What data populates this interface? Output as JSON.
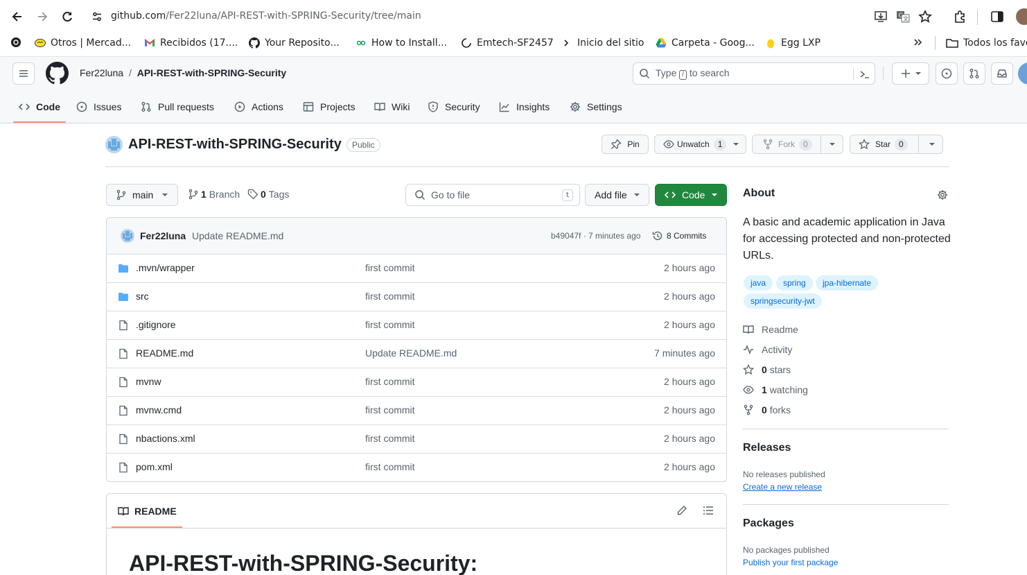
{
  "browser": {
    "url_host": "github.com",
    "url_path": "/Fer22luna/API-REST-with-SPRING-Security/tree/main",
    "bookmarks": [
      {
        "label": "Otros | Mercad...",
        "icon": "mercadolibre-icon"
      },
      {
        "label": "Recibidos (17....",
        "icon": "gmail-icon"
      },
      {
        "label": "Your Reposito...",
        "icon": "github-icon"
      },
      {
        "label": "How to Install...",
        "icon": "link-icon"
      },
      {
        "label": "Emtech-SF2457",
        "icon": "loading-icon"
      },
      {
        "label": "Inicio del sitio",
        "icon": "arrow-icon"
      },
      {
        "label": "Carpeta - Goog...",
        "icon": "drive-icon"
      },
      {
        "label": "Egg LXP",
        "icon": "egg-icon"
      }
    ],
    "all_bookmarks": "Todos los favo"
  },
  "header": {
    "owner": "Fer22luna",
    "separator": "/",
    "repo": "API-REST-with-SPRING-Security",
    "search_placeholder_pre": "Type",
    "search_key": "/",
    "search_placeholder_post": "to search"
  },
  "tabs": [
    {
      "label": "Code",
      "icon": "code-icon",
      "selected": true
    },
    {
      "label": "Issues",
      "icon": "issue-icon"
    },
    {
      "label": "Pull requests",
      "icon": "pull-request-icon"
    },
    {
      "label": "Actions",
      "icon": "play-icon"
    },
    {
      "label": "Projects",
      "icon": "table-icon"
    },
    {
      "label": "Wiki",
      "icon": "book-icon"
    },
    {
      "label": "Security",
      "icon": "shield-icon"
    },
    {
      "label": "Insights",
      "icon": "graph-icon"
    },
    {
      "label": "Settings",
      "icon": "gear-icon"
    }
  ],
  "repo": {
    "name": "API-REST-with-SPRING-Security",
    "visibility": "Public",
    "pin": "Pin",
    "unwatch": "Unwatch",
    "watch_count": "1",
    "fork": "Fork",
    "fork_count": "0",
    "star": "Star",
    "star_count": "0"
  },
  "toolbar": {
    "branch": "main",
    "branch_count": "1",
    "branch_label": "Branch",
    "tag_count": "0",
    "tag_label": "Tags",
    "goto_placeholder": "Go to file",
    "goto_key": "t",
    "add_file": "Add file",
    "code": "Code"
  },
  "commit": {
    "author": "Fer22luna",
    "message": "Update README.md",
    "hash_age": "b49047f · 7 minutes ago",
    "commits": "8 Commits"
  },
  "files": [
    {
      "name": ".mvn/wrapper",
      "type": "folder",
      "message": "first commit",
      "age": "2 hours ago"
    },
    {
      "name": "src",
      "type": "folder",
      "message": "first commit",
      "age": "2 hours ago"
    },
    {
      "name": ".gitignore",
      "type": "file",
      "message": "first commit",
      "age": "2 hours ago"
    },
    {
      "name": "README.md",
      "type": "file",
      "message": "Update README.md",
      "age": "7 minutes ago"
    },
    {
      "name": "mvnw",
      "type": "file",
      "message": "first commit",
      "age": "2 hours ago"
    },
    {
      "name": "mvnw.cmd",
      "type": "file",
      "message": "first commit",
      "age": "2 hours ago"
    },
    {
      "name": "nbactions.xml",
      "type": "file",
      "message": "first commit",
      "age": "2 hours ago"
    },
    {
      "name": "pom.xml",
      "type": "file",
      "message": "first commit",
      "age": "2 hours ago"
    }
  ],
  "readme": {
    "tab": "README",
    "heading": "API-REST-with-SPRING-Security:"
  },
  "about": {
    "title": "About",
    "description": "A basic and academic application in Java for accessing protected and non-protected URLs.",
    "topics": [
      "java",
      "spring",
      "jpa-hibernate",
      "springsecurity-jwt"
    ],
    "readme": "Readme",
    "activity": "Activity",
    "stars_count": "0",
    "stars_label": "stars",
    "watching_count": "1",
    "watching_label": "watching",
    "forks_count": "0",
    "forks_label": "forks"
  },
  "releases": {
    "title": "Releases",
    "empty": "No releases published",
    "create": "Create a new release"
  },
  "packages": {
    "title": "Packages",
    "empty": "No packages published",
    "publish": "Publish your first package"
  },
  "colors": {
    "accent": "#0969da",
    "code_button": "#1f883d",
    "tab_underline": "#fd8c73",
    "folder": "#54aeff"
  }
}
